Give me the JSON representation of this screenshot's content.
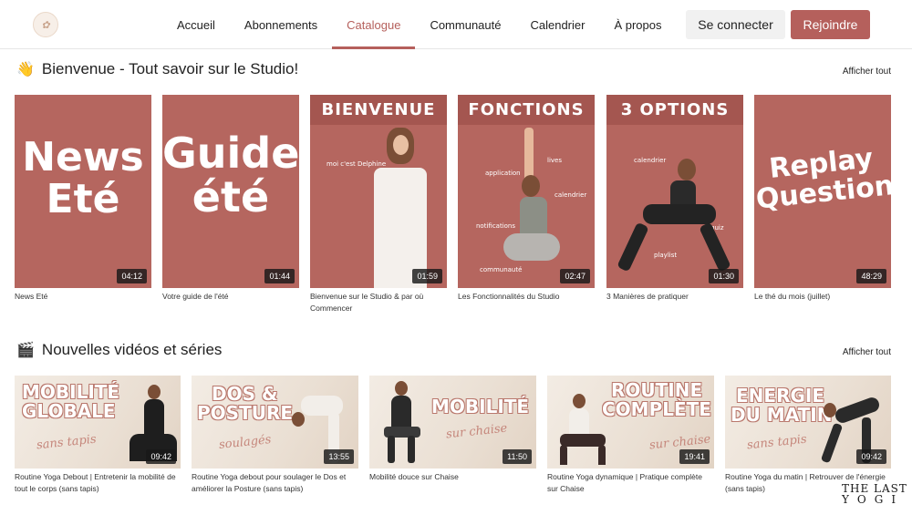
{
  "header": {
    "nav": [
      "Accueil",
      "Abonnements",
      "Catalogue",
      "Communauté",
      "Calendrier",
      "À propos"
    ],
    "active_nav": "Catalogue",
    "login_label": "Se connecter",
    "join_label": "Rejoindre"
  },
  "colors": {
    "accent": "#b5605c",
    "thumb_bg": "#b5665f",
    "banner_bg": "#a45650"
  },
  "section1": {
    "emoji": "👋",
    "title": "Bienvenue - Tout savoir sur le Studio!",
    "see_all": "Afficher tout",
    "cards": [
      {
        "thumb_text": [
          "News",
          "Eté"
        ],
        "duration": "04:12",
        "caption": "News Eté"
      },
      {
        "thumb_text": [
          "Guide",
          "été"
        ],
        "duration": "01:44",
        "caption": "Votre guide de l'été"
      },
      {
        "banner": "BIENVENUE",
        "notes": [
          "moi c'est Delphine"
        ],
        "duration": "01:59",
        "caption": "Bienvenue sur le Studio & par où Commencer"
      },
      {
        "banner": "FONCTIONS",
        "notes": [
          "application",
          "lives",
          "calendrier",
          "notifications",
          "communauté"
        ],
        "duration": "02:47",
        "caption": "Les Fonctionnalités du Studio"
      },
      {
        "banner": "3 OPTIONS",
        "notes": [
          "calendrier",
          "quiz",
          "playlist"
        ],
        "duration": "01:30",
        "caption": "3 Manières de pratiquer"
      },
      {
        "thumb_text": [
          "Replay",
          "Questions"
        ],
        "duration": "48:29",
        "caption": "Le thé du mois (juillet)"
      }
    ]
  },
  "section2": {
    "emoji": "🎬",
    "title": "Nouvelles vidéos et séries",
    "see_all": "Afficher tout",
    "cards": [
      {
        "title": [
          "MOBILITÉ",
          "GLOBALE"
        ],
        "subtitle": "sans tapis",
        "duration": "09:42",
        "caption": "Routine Yoga Debout | Entretenir la mobilité de tout le corps (sans tapis)"
      },
      {
        "title": [
          "DOS &",
          "POSTURE"
        ],
        "subtitle": "soulagés",
        "duration": "13:55",
        "caption": "Routine Yoga debout pour soulager le Dos et améliorer la Posture (sans tapis)"
      },
      {
        "title": [
          "MOBILITÉ"
        ],
        "subtitle": "sur chaise",
        "duration": "11:50",
        "caption": "Mobilité douce sur Chaise"
      },
      {
        "title": [
          "ROUTINE",
          "COMPLÈTE"
        ],
        "subtitle": "sur chaise",
        "duration": "19:41",
        "caption": "Routine Yoga dynamique | Pratique complète sur Chaise"
      },
      {
        "title": [
          "ENERGIE",
          "DU MATIN"
        ],
        "subtitle": "sans tapis",
        "duration": "09:42",
        "caption": "Routine Yoga du matin | Retrouver de l'énergie (sans tapis)"
      }
    ]
  },
  "watermark": [
    "THE LAST",
    "YOGI"
  ]
}
